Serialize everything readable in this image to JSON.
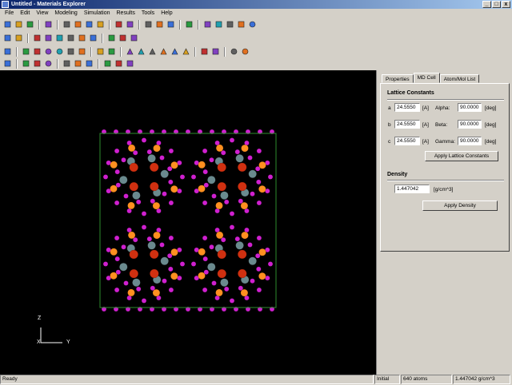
{
  "window": {
    "title": "Untitled - Materials Explorer",
    "controls": {
      "minimize": "_",
      "maximize": "□",
      "close": "x"
    }
  },
  "menu": [
    "File",
    "Edit",
    "View",
    "Modeling",
    "Simulation",
    "Results",
    "Tools",
    "Help"
  ],
  "toolbars": {
    "row1": [
      "new-file-icon",
      "open-folder-icon",
      "save-icon",
      "sep",
      "print-icon",
      "sep",
      "cut-icon",
      "copy-icon",
      "paste-icon",
      "delete-icon",
      "sep",
      "molecule-icon",
      "graph-icon",
      "sep",
      "cylinder-icon",
      "battery-icon",
      "grid-icon",
      "sep",
      "undo-icon",
      "sep",
      "doc-a-icon",
      "doc-b-icon",
      "doc-c-icon",
      "doc-d-icon",
      "refresh-icon"
    ],
    "row2": [
      "crystal-icon",
      "table-icon",
      "sep",
      "crystal-red-icon",
      "crystal-blue-icon",
      "crystal-green-icon",
      "crystal-violet-icon",
      "crystal-pink-icon",
      "crystal-dark-icon",
      "sep",
      "black-grid-icon",
      "image-icon",
      "frame-icon"
    ],
    "row3": [
      "select-icon",
      "sep",
      "cube-icon",
      "cube-alt-icon",
      "rotate-icon",
      "spin-icon",
      "move-icon",
      "box-yellow-icon",
      "sep",
      "fit-icon",
      "line-icon",
      "sep",
      "angle-a-icon",
      "angle-b-icon",
      "triangle-a-icon",
      "triangle-b-icon",
      "triangle-c-icon",
      "triangle-d-icon",
      "sep",
      "dash-icon",
      "grid-small-icon",
      "sep",
      "refresh-b-icon",
      "atom-icon"
    ],
    "row4": [
      "cross-icon",
      "sep",
      "horizontal-arrows-icon",
      "vertical-arrows-icon",
      "curve-icon",
      "sep",
      "axis-x-icon",
      "axis-y-icon",
      "axis-z-icon",
      "sep",
      "frame-a-icon",
      "frame-b-icon",
      "frame-c-icon"
    ]
  },
  "colors": {
    "atom_magenta": "#d020d0",
    "atom_orange": "#ff9020",
    "atom_red": "#d03010",
    "atom_gray": "#6a8a8e",
    "cell_edge": "#2e8b2e",
    "title_bar": "#0a246a"
  },
  "axes": {
    "z": "Z",
    "x": "X",
    "y": "Y"
  },
  "panel": {
    "tabs": [
      "Properties",
      "MD Cell",
      "Atom/Mol List"
    ],
    "active_tab": "MD Cell",
    "lattice": {
      "title": "Lattice Constants",
      "rows": [
        {
          "axis": "a",
          "length": "24.5550",
          "unit": "[A]",
          "angle_label": "Alpha:",
          "angle": "90.0000",
          "angle_unit": "[deg]"
        },
        {
          "axis": "b",
          "length": "24.5550",
          "unit": "[A]",
          "angle_label": "Beta:",
          "angle": "90.0000",
          "angle_unit": "[deg]"
        },
        {
          "axis": "c",
          "length": "24.5550",
          "unit": "[A]",
          "angle_label": "Gamma:",
          "angle": "90.0000",
          "angle_unit": "[deg]"
        }
      ],
      "apply_button": "Apply Lattice Constants"
    },
    "density": {
      "title": "Density",
      "value": "1.447042",
      "unit": "[g/cm^3]",
      "apply_button": "Apply Density"
    }
  },
  "status": {
    "ready": "Ready",
    "mode": "Initial",
    "atoms": "640 atoms",
    "density": "1.447042 g/cm^3"
  }
}
